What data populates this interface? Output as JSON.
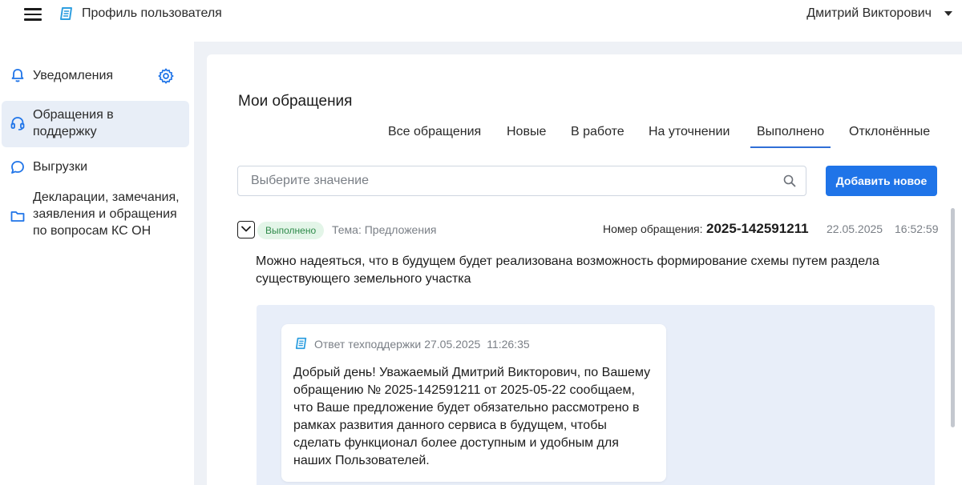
{
  "header": {
    "app_title": "Профиль пользователя",
    "user_name": "Дмитрий Викторович",
    "brand_color": "#2f9fe0"
  },
  "sidebar": {
    "items": [
      {
        "label": "Уведомления",
        "icon": "bell-icon"
      },
      {
        "label": "Обращения в поддержку",
        "icon": "headset-icon",
        "active": true
      },
      {
        "label": "Выгрузки",
        "icon": "chat-bubble-icon"
      },
      {
        "label": "Декларации, замечания, заявления и обращения по вопросам КС ОН",
        "icon": "folder-icon"
      }
    ],
    "settings_icon": "gear-icon"
  },
  "main": {
    "title": "Мои обращения",
    "tabs": [
      {
        "label": "Все обращения"
      },
      {
        "label": "Новые"
      },
      {
        "label": "В работе"
      },
      {
        "label": "На уточнении"
      },
      {
        "label": "Выполнено",
        "active": true
      },
      {
        "label": "Отклонённые"
      }
    ],
    "search": {
      "placeholder": "Выберите значение",
      "value": ""
    },
    "add_button": "Добавить новое",
    "accent_color": "#1f74e8"
  },
  "ticket": {
    "status": "Выполнено",
    "status_color": "#2e8a4a",
    "topic": "Тема: Предложения",
    "number_label": "Номер обращения:",
    "number": "2025-142591211",
    "date": "22.05.2025",
    "time": "16:52:59",
    "text": "Можно надеяться, что в будущем будет реализована возможность формирование схемы путем раздела существующего земельного участка",
    "reply": {
      "author": "Ответ техподдержки",
      "date": "27.05.2025",
      "time": "11:26:35",
      "text": "Добрый день! Уважаемый Дмитрий Викторович, по Вашему обращению № 2025-142591211 от 2025-05-22 сообщаем, что Ваше предложение будет обязательно рассмотрено в рамках развития данного сервиса в будущем, чтобы сделать функционал более доступным и удобным для наших Пользователей."
    }
  }
}
